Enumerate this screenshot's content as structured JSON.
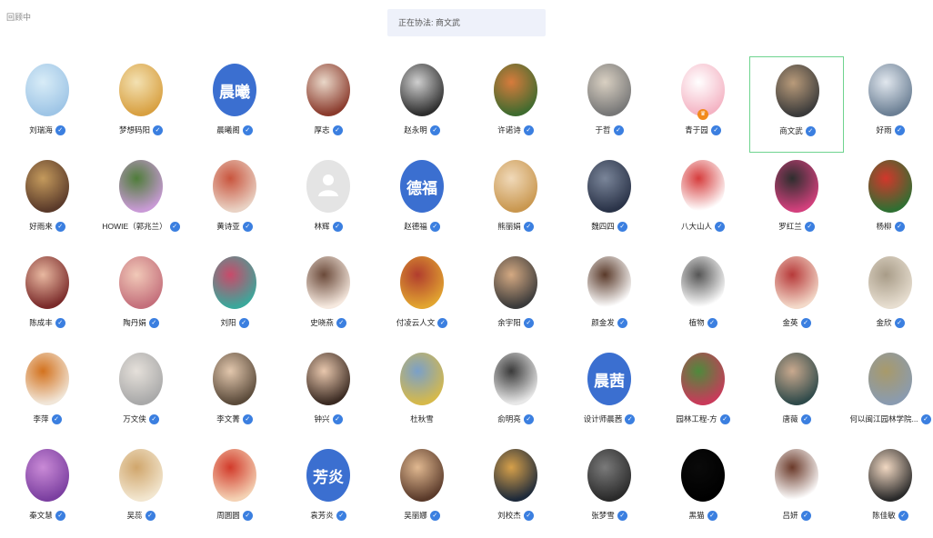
{
  "header": {
    "top_label": "回顾中",
    "status_text": "正在协法: 商文武"
  },
  "grid": {
    "rows": [
      [
        {
          "name": "刘瑞海",
          "kind": "image",
          "colors": [
            "#9ec5e6",
            "#d8ecf7"
          ],
          "verified": true
        },
        {
          "name": "梦想码阳",
          "kind": "image",
          "colors": [
            "#d8a041",
            "#f3e1b2"
          ],
          "verified": true
        },
        {
          "name": "晨曦阁",
          "kind": "text",
          "text": "晨曦",
          "verified": true
        },
        {
          "name": "厚志",
          "kind": "image",
          "colors": [
            "#8a3a2c",
            "#e9d7c8"
          ],
          "verified": true
        },
        {
          "name": "赵永明",
          "kind": "image",
          "colors": [
            "#2e2e2e",
            "#cfcfcf"
          ],
          "verified": true
        },
        {
          "name": "许诺诗",
          "kind": "image",
          "colors": [
            "#3f6b2f",
            "#d77b3c"
          ],
          "verified": true
        },
        {
          "name": "于哲",
          "kind": "image",
          "colors": [
            "#777777",
            "#d9d0c2"
          ],
          "verified": true
        },
        {
          "name": "青于园",
          "kind": "image",
          "colors": [
            "#f4b3c3",
            "#ffffff"
          ],
          "verified": true,
          "sub_badge": true
        },
        {
          "name": "商文武",
          "kind": "image",
          "colors": [
            "#3a3a3a",
            "#b99b7a"
          ],
          "verified": true,
          "selected": true
        },
        {
          "name": "好雨",
          "kind": "image",
          "colors": [
            "#6b7f94",
            "#e1e7ee"
          ],
          "verified": true
        }
      ],
      [
        {
          "name": "好雨来",
          "kind": "image",
          "colors": [
            "#5a3a2a",
            "#c49a5c"
          ],
          "verified": true
        },
        {
          "name": "HOWIE（郭兆兰）",
          "kind": "image",
          "colors": [
            "#c99ad6",
            "#4f7d3a"
          ],
          "verified": true
        },
        {
          "name": "黄诗亚",
          "kind": "image",
          "colors": [
            "#e9d2c4",
            "#c9553e"
          ],
          "verified": true
        },
        {
          "name": "林辉",
          "kind": "placeholder",
          "colors": [
            "#e2e2e2",
            "#ffffff"
          ],
          "verified": true
        },
        {
          "name": "赵德福",
          "kind": "text",
          "text": "德福",
          "verified": true
        },
        {
          "name": "熊丽娟",
          "kind": "image",
          "colors": [
            "#c9974f",
            "#f0d9b9"
          ],
          "verified": true
        },
        {
          "name": "魏四四",
          "kind": "image",
          "colors": [
            "#2a3348",
            "#7a8599"
          ],
          "verified": true
        },
        {
          "name": "八大山人",
          "kind": "image",
          "colors": [
            "#ffffff",
            "#d63d3d"
          ],
          "verified": true
        },
        {
          "name": "罗红兰",
          "kind": "image",
          "colors": [
            "#d3407d",
            "#2e2e2e"
          ],
          "verified": true
        },
        {
          "name": "杨柳",
          "kind": "image",
          "colors": [
            "#2f6f32",
            "#d2372b"
          ],
          "verified": true
        }
      ],
      [
        {
          "name": "陈成丰",
          "kind": "image",
          "colors": [
            "#7a2a2a",
            "#e8b8a0"
          ],
          "verified": true
        },
        {
          "name": "陶丹娟",
          "kind": "image",
          "colors": [
            "#c46f7b",
            "#f1c9b8"
          ],
          "verified": true
        },
        {
          "name": "刘阳",
          "kind": "image",
          "colors": [
            "#3aa89b",
            "#c94a6a"
          ],
          "verified": true
        },
        {
          "name": "史晓燕",
          "kind": "image",
          "colors": [
            "#f6e9df",
            "#6b4a3a"
          ],
          "verified": true
        },
        {
          "name": "付凌云人文",
          "kind": "image",
          "colors": [
            "#e2a530",
            "#b13d2e"
          ],
          "verified": true
        },
        {
          "name": "余宇阳",
          "kind": "image",
          "colors": [
            "#3a3a3a",
            "#d4a982"
          ],
          "verified": true
        },
        {
          "name": "颜金发",
          "kind": "image",
          "colors": [
            "#ffffff",
            "#5a3a2a"
          ],
          "verified": true
        },
        {
          "name": "植物",
          "kind": "image",
          "colors": [
            "#ffffff",
            "#555555"
          ],
          "verified": true
        },
        {
          "name": "金英",
          "kind": "image",
          "colors": [
            "#f3d9c9",
            "#b73a3a"
          ],
          "verified": true
        },
        {
          "name": "金欣",
          "kind": "image",
          "colors": [
            "#e7ded0",
            "#a89c88"
          ],
          "verified": true
        }
      ],
      [
        {
          "name": "李萍",
          "kind": "image",
          "colors": [
            "#f1e6d8",
            "#d3721e"
          ],
          "verified": true
        },
        {
          "name": "万文侠",
          "kind": "image",
          "colors": [
            "#a9a9a9",
            "#e5e0da"
          ],
          "verified": true
        },
        {
          "name": "李文菁",
          "kind": "image",
          "colors": [
            "#5a4a3a",
            "#e2c7ad"
          ],
          "verified": true
        },
        {
          "name": "钟兴",
          "kind": "image",
          "colors": [
            "#3a2a22",
            "#e8c7ad"
          ],
          "verified": true
        },
        {
          "name": "杜秋雪",
          "kind": "image",
          "colors": [
            "#d6b94a",
            "#7aa0c9"
          ],
          "verified": false
        },
        {
          "name": "俞明亮",
          "kind": "image",
          "colors": [
            "#e8e8e8",
            "#3a3a3a"
          ],
          "verified": true
        },
        {
          "name": "设计师晨茜",
          "kind": "text",
          "text": "晨茜",
          "verified": true
        },
        {
          "name": "园林工程-方",
          "kind": "image",
          "colors": [
            "#c93a5a",
            "#4e8a3c"
          ],
          "verified": true
        },
        {
          "name": "唐薇",
          "kind": "image",
          "colors": [
            "#2f4a4a",
            "#c9a98e"
          ],
          "verified": true
        },
        {
          "name": "何以闽江园林学院...",
          "kind": "image",
          "colors": [
            "#8a9bb0",
            "#a89a6a"
          ],
          "verified": true
        }
      ],
      [
        {
          "name": "秦文慧",
          "kind": "image",
          "colors": [
            "#7b3fa0",
            "#c98ad6"
          ],
          "verified": true
        },
        {
          "name": "吴蕊",
          "kind": "image",
          "colors": [
            "#f2e6cf",
            "#d0a66c"
          ],
          "verified": true
        },
        {
          "name": "周圆圆",
          "kind": "image",
          "colors": [
            "#f4d2b4",
            "#d23b2b"
          ],
          "verified": true
        },
        {
          "name": "袁芳炎",
          "kind": "text",
          "text": "芳炎",
          "verified": true
        },
        {
          "name": "吴丽娜",
          "kind": "image",
          "colors": [
            "#5a3a2a",
            "#e0b890"
          ],
          "verified": true
        },
        {
          "name": "刘校杰",
          "kind": "image",
          "colors": [
            "#1e2a3a",
            "#d6a04a"
          ],
          "verified": true
        },
        {
          "name": "张梦雪",
          "kind": "image",
          "colors": [
            "#2a2a2a",
            "#7a7a7a"
          ],
          "verified": true
        },
        {
          "name": "黑猫",
          "kind": "image",
          "colors": [
            "#000000",
            "#0a0a0a"
          ],
          "verified": true
        },
        {
          "name": "吕妍",
          "kind": "image",
          "colors": [
            "#ffffff",
            "#6b3a2a"
          ],
          "verified": true
        },
        {
          "name": "陈佳敏",
          "kind": "image",
          "colors": [
            "#2a2a2a",
            "#f1d8c2"
          ],
          "verified": true
        }
      ]
    ]
  },
  "icons": {
    "verified": "verified-icon",
    "placeholder": "user-silhouette-icon",
    "sub_badge": "crown-icon"
  },
  "colors": {
    "accent": "#3b7fe0",
    "selected_border": "#6fd48f",
    "text_avatar_bg": "#3b6fd0"
  }
}
